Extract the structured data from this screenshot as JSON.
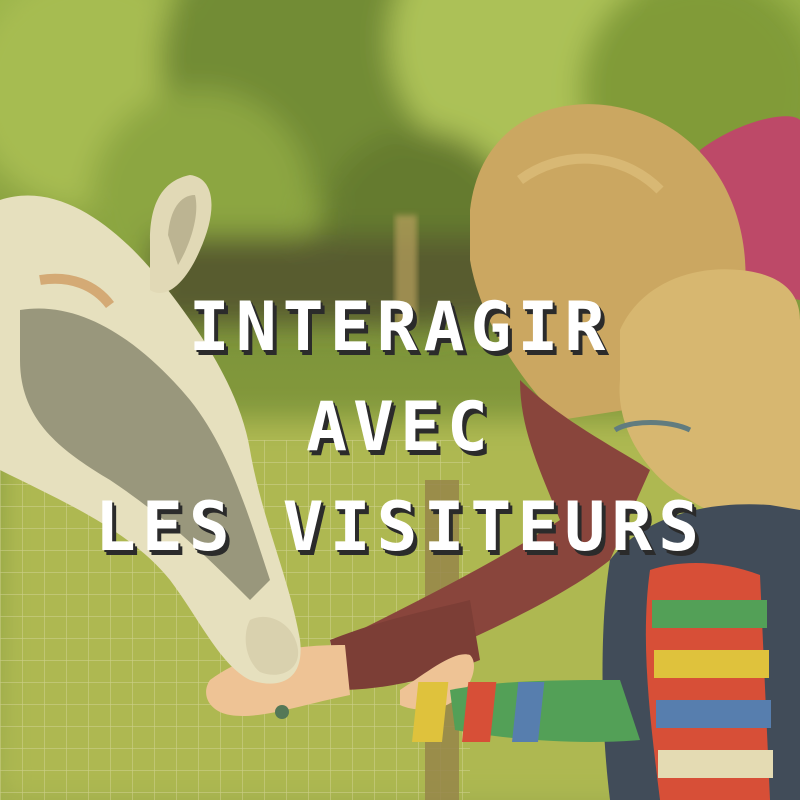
{
  "caption": {
    "lines": [
      "INTERAGIR",
      "AVEC",
      "LES VISITEURS"
    ],
    "text_color": "#ffffff",
    "shadow_color": "#2b2b2b"
  },
  "palette": {
    "foliage": "#7a9b3c",
    "grass": "#9bb24a",
    "llama_fleece": "#e9e6d4",
    "llama_grey": "#8d8f86",
    "adult_sweater": "#7a2e3a",
    "adult_hair": "#c9a266",
    "child_hair": "#d7b678",
    "vest": "#24365c",
    "magenta_jacket": "#b8336e",
    "overlay_tint": "#d8c24a"
  }
}
